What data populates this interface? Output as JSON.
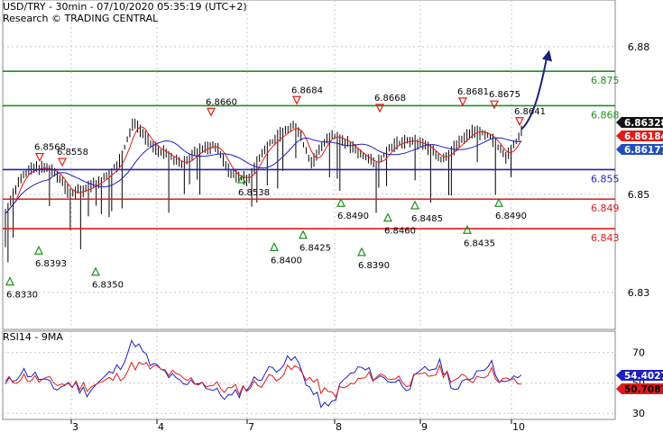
{
  "header": {
    "line1": "USD/TRY - 30min - 07/10/2020 05:35:19 (UTC+2)",
    "line2": "Research © TRADING CENTRAL"
  },
  "chart_data": [
    {
      "type": "line",
      "title": "USD/TRY - 30min - 07/10/2020 05:35:19 (UTC+2)",
      "ylim": [
        6.8225,
        6.8895
      ],
      "y_ticks": [
        "6.88",
        "6.85",
        "6.83"
      ],
      "x_ticks": [
        "3",
        "4",
        "7",
        "8",
        "9",
        "10"
      ],
      "series": [
        {
          "name": "Close",
          "values": [
            6.846,
            6.854,
            6.8555,
            6.8548,
            6.85,
            6.851,
            6.853,
            6.856,
            6.865,
            6.86,
            6.858,
            6.856,
            6.859,
            6.86,
            6.854,
            6.853,
            6.859,
            6.862,
            6.864,
            6.856,
            6.862,
            6.861,
            6.858,
            6.856,
            6.86,
            6.861,
            6.86,
            6.857,
            6.86,
            6.863,
            6.862,
            6.8575,
            6.8625
          ]
        }
      ],
      "horizontal_levels": [
        {
          "value": 6.875,
          "label": "6.875",
          "color": "#1f8f1f"
        },
        {
          "value": 6.868,
          "label": "6.868",
          "color": "#1f8f1f"
        },
        {
          "value": 6.855,
          "label": "6.855",
          "color": "#1f1fbf"
        },
        {
          "value": 6.849,
          "label": "6.849",
          "color": "#e01a1a"
        },
        {
          "value": 6.843,
          "label": "6.843",
          "color": "#e01a1a"
        }
      ],
      "price_tags": [
        {
          "label": "6.86328",
          "value": 6.86328,
          "bg": "#111111",
          "fg": "#ffffff"
        },
        {
          "label": "6.86184",
          "value": 6.86184,
          "bg": "#e01a1a",
          "fg": "#ffffff"
        },
        {
          "label": "6.86177",
          "value": 6.86177,
          "bg": "#1f4fbf",
          "fg": "#ffffff"
        }
      ],
      "highs": [
        {
          "label": "6.8568",
          "value": 6.8568
        },
        {
          "label": "6.8558",
          "value": 6.8558
        },
        {
          "label": "6.8660",
          "value": 6.866
        },
        {
          "label": "6.8684",
          "value": 6.8684
        },
        {
          "label": "6.8668",
          "value": 6.8668
        },
        {
          "label": "6.8681",
          "value": 6.8681
        },
        {
          "label": "6.8675",
          "value": 6.8675
        },
        {
          "label": "6.8641",
          "value": 6.8641
        }
      ],
      "lows": [
        {
          "label": "6.8330",
          "value": 6.833
        },
        {
          "label": "6.8393",
          "value": 6.8393
        },
        {
          "label": "6.8350",
          "value": 6.835
        },
        {
          "label": "6.8538",
          "value": 6.8538
        },
        {
          "label": "6.8400",
          "value": 6.84
        },
        {
          "label": "6.8425",
          "value": 6.8425
        },
        {
          "label": "6.8490",
          "value": 6.849
        },
        {
          "label": "6.8390",
          "value": 6.839
        },
        {
          "label": "6.8460",
          "value": 6.846
        },
        {
          "label": "6.8485",
          "value": 6.8485
        },
        {
          "label": "6.8435",
          "value": 6.8435
        },
        {
          "label": "6.8490",
          "value": 6.849
        }
      ],
      "colors": {
        "bars": "#000000",
        "ma_red": "#e01a1a",
        "ma_blue": "#1f1fbf",
        "arrow": "#1a237e",
        "grid": "#c8c8c8"
      }
    },
    {
      "type": "line",
      "title": "RSI14 - 9MA",
      "ylim": [
        26,
        84
      ],
      "y_ticks": [
        "70",
        "50",
        "30"
      ],
      "series": [
        {
          "name": "RSI14",
          "values": [
            48,
            58,
            54,
            46,
            50,
            44,
            52,
            60,
            78,
            62,
            56,
            48,
            52,
            44,
            40,
            48,
            56,
            62,
            66,
            44,
            32,
            52,
            60,
            54,
            52,
            48,
            58,
            62,
            44,
            56,
            64,
            48,
            56
          ]
        },
        {
          "name": "9MA",
          "values": [
            50,
            54,
            52,
            50,
            49,
            48,
            50,
            54,
            62,
            60,
            57,
            52,
            51,
            48,
            45,
            47,
            51,
            56,
            60,
            52,
            42,
            46,
            52,
            55,
            54,
            51,
            54,
            58,
            52,
            53,
            58,
            51,
            50
          ]
        }
      ],
      "value_tags": [
        {
          "label": "54.4027",
          "value": 54.4027,
          "bg": "#1f1fbf",
          "fg": "#ffffff"
        },
        {
          "label": "50.7087",
          "value": 50.7087,
          "bg": "#e01a1a",
          "fg": "#000000"
        }
      ]
    }
  ]
}
